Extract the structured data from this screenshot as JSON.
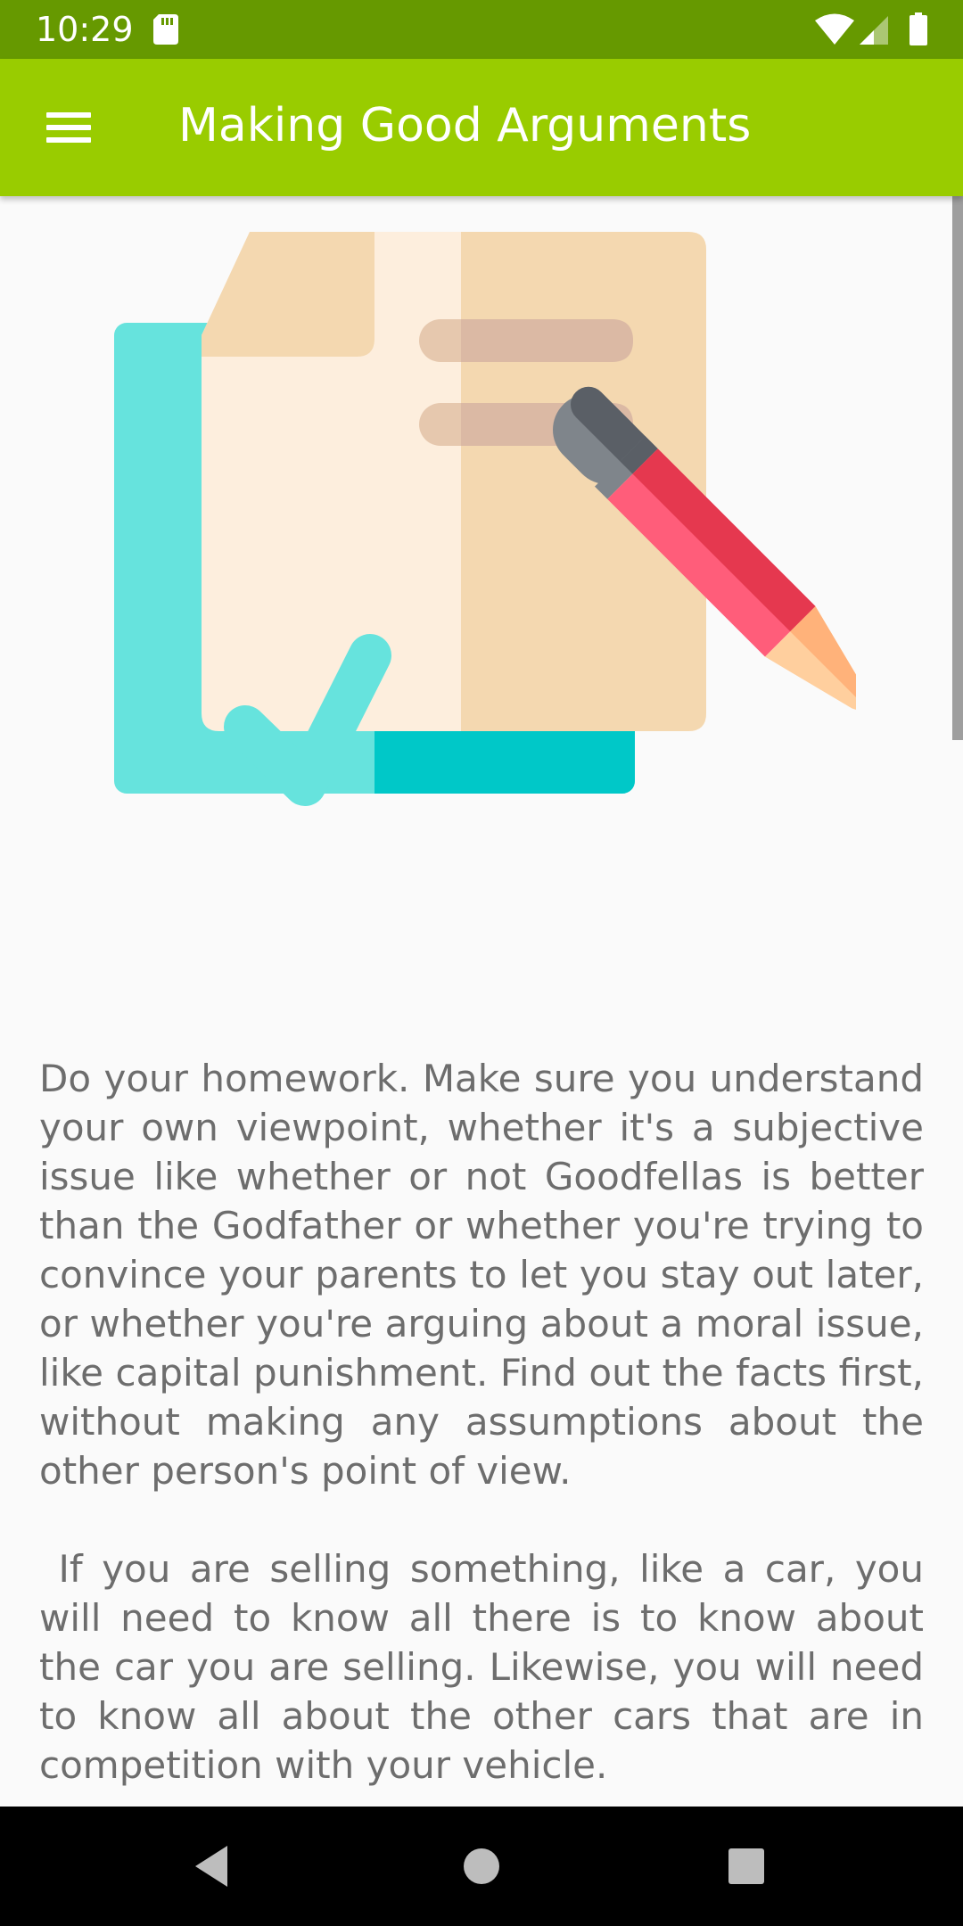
{
  "status_bar": {
    "time": "10:29",
    "icons": [
      "sd-card-icon",
      "wifi-icon",
      "cell-signal-icon",
      "battery-icon"
    ]
  },
  "app_bar": {
    "title": "Making Good Arguments",
    "menu_icon": "menu-icon"
  },
  "illustration": {
    "icon": "document-checklist-pencil-illustration",
    "colors": {
      "teal_light": "#66e3dd",
      "teal_dark": "#00c8c8",
      "paper_light": "#fdeedd",
      "paper_dark": "#f4d8b0",
      "pencil_pink": "#ff5d7a",
      "pencil_red": "#e5384f",
      "eraser_grey": "#7f858b"
    }
  },
  "article": {
    "paragraphs": [
      "Do your homework. Make sure you understand your own viewpoint, whether it's a subjective issue like whether or not Goodfellas is better than the Godfather or whether you're trying to convince your parents to let you stay out later, or whether you're arguing about a moral issue, like capital punishment. Find out the facts first, without making any assumptions about the other person's point of view.",
      " If you are selling something, like a car, you will need to know all there is to know about the car you are selling. Likewise, you will need to know all about the other cars that are in competition with your vehicle."
    ]
  },
  "nav_bar": {
    "icons": [
      "back-icon",
      "home-icon",
      "recents-icon"
    ]
  },
  "colors": {
    "status_bar": "#669900",
    "app_bar": "#99cc00",
    "background": "#fafafa",
    "text": "#6d6d6d"
  }
}
